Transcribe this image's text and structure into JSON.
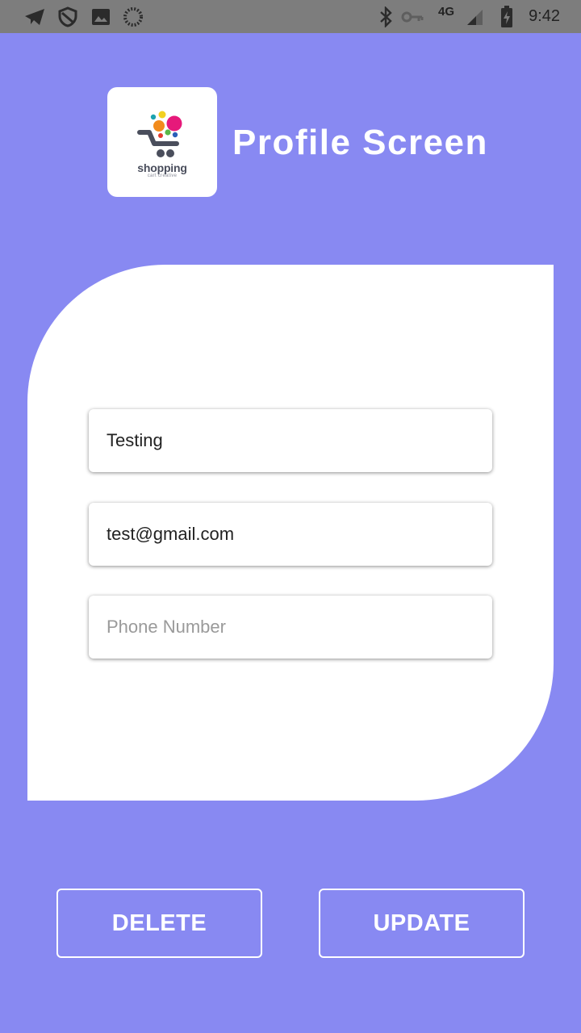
{
  "status_bar": {
    "time": "9:42",
    "network": "4G",
    "icons": [
      "telegram-icon",
      "shield-icon",
      "image-icon",
      "loading-icon",
      "bluetooth-icon",
      "vpn-key-icon",
      "signal-icon",
      "battery-charging-icon"
    ]
  },
  "header": {
    "title": "Profile Screen",
    "logo": {
      "word": "shopping",
      "subtitle": "cart creative"
    }
  },
  "form": {
    "name": {
      "value": "Testing",
      "placeholder": ""
    },
    "email": {
      "value": "test@gmail.com",
      "placeholder": ""
    },
    "phone": {
      "value": "",
      "placeholder": "Phone Number"
    }
  },
  "actions": {
    "delete_label": "DELETE",
    "update_label": "UPDATE"
  },
  "colors": {
    "background": "#8889f2",
    "status_bar": "#7d7d7d",
    "card": "#ffffff"
  }
}
